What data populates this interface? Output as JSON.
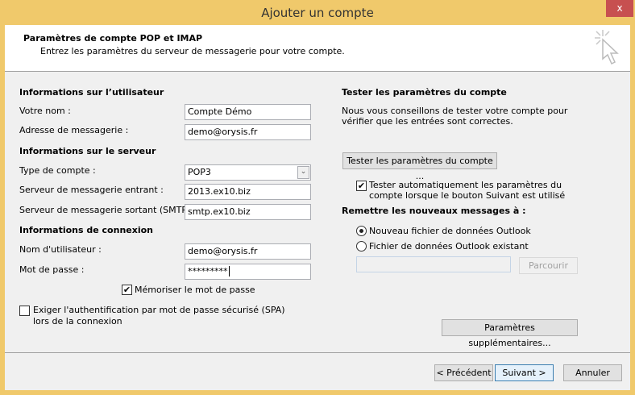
{
  "window": {
    "title": "Ajouter un compte",
    "close": "x"
  },
  "header": {
    "title": "Paramètres de compte POP et IMAP",
    "subtitle": "Entrez les paramètres du serveur de messagerie pour votre compte.",
    "icon": "cursor-click-icon"
  },
  "user": {
    "section": "Informations sur l’utilisateur",
    "name_label": "Votre nom :",
    "name_value": "Compte Démo",
    "email_label": "Adresse de messagerie :",
    "email_value": "demo@orysis.fr"
  },
  "server": {
    "section": "Informations sur le serveur",
    "type_label": "Type de compte :",
    "type_value": "POP3",
    "incoming_label": "Serveur de messagerie entrant :",
    "incoming_value": "2013.ex10.biz",
    "outgoing_label": "Serveur de messagerie sortant (SMTP) :",
    "outgoing_value": "smtp.ex10.biz"
  },
  "login": {
    "section": "Informations de connexion",
    "user_label": "Nom d'utilisateur :",
    "user_value": "demo@orysis.fr",
    "password_label": "Mot de passe :",
    "password_value": "*********",
    "remember_label": "Mémoriser le mot de passe",
    "remember_checked": true,
    "spa_label_1": "Exiger l'authentification par mot de passe sécurisé (SPA)",
    "spa_label_2": "lors de la connexion",
    "spa_checked": false
  },
  "test": {
    "section": "Tester les paramètres du compte",
    "desc_1": "Nous vous conseillons de tester votre compte pour",
    "desc_2": "vérifier que les entrées sont correctes.",
    "button": "Tester les paramètres du compte ...",
    "auto_label_1": "Tester automatiquement les paramètres du",
    "auto_label_2": "compte lorsque le bouton Suivant est utilisé",
    "auto_checked": true
  },
  "deliver": {
    "section": "Remettre les nouveaux messages à :",
    "option_new": "Nouveau fichier de données Outlook",
    "option_existing": "Fichier de données Outlook existant",
    "selected": "new",
    "path_value": "",
    "browse": "Parcourir"
  },
  "more_settings": "Paramètres supplémentaires...",
  "footer": {
    "back": "< Précédent",
    "next": "Suivant >",
    "cancel": "Annuler"
  }
}
